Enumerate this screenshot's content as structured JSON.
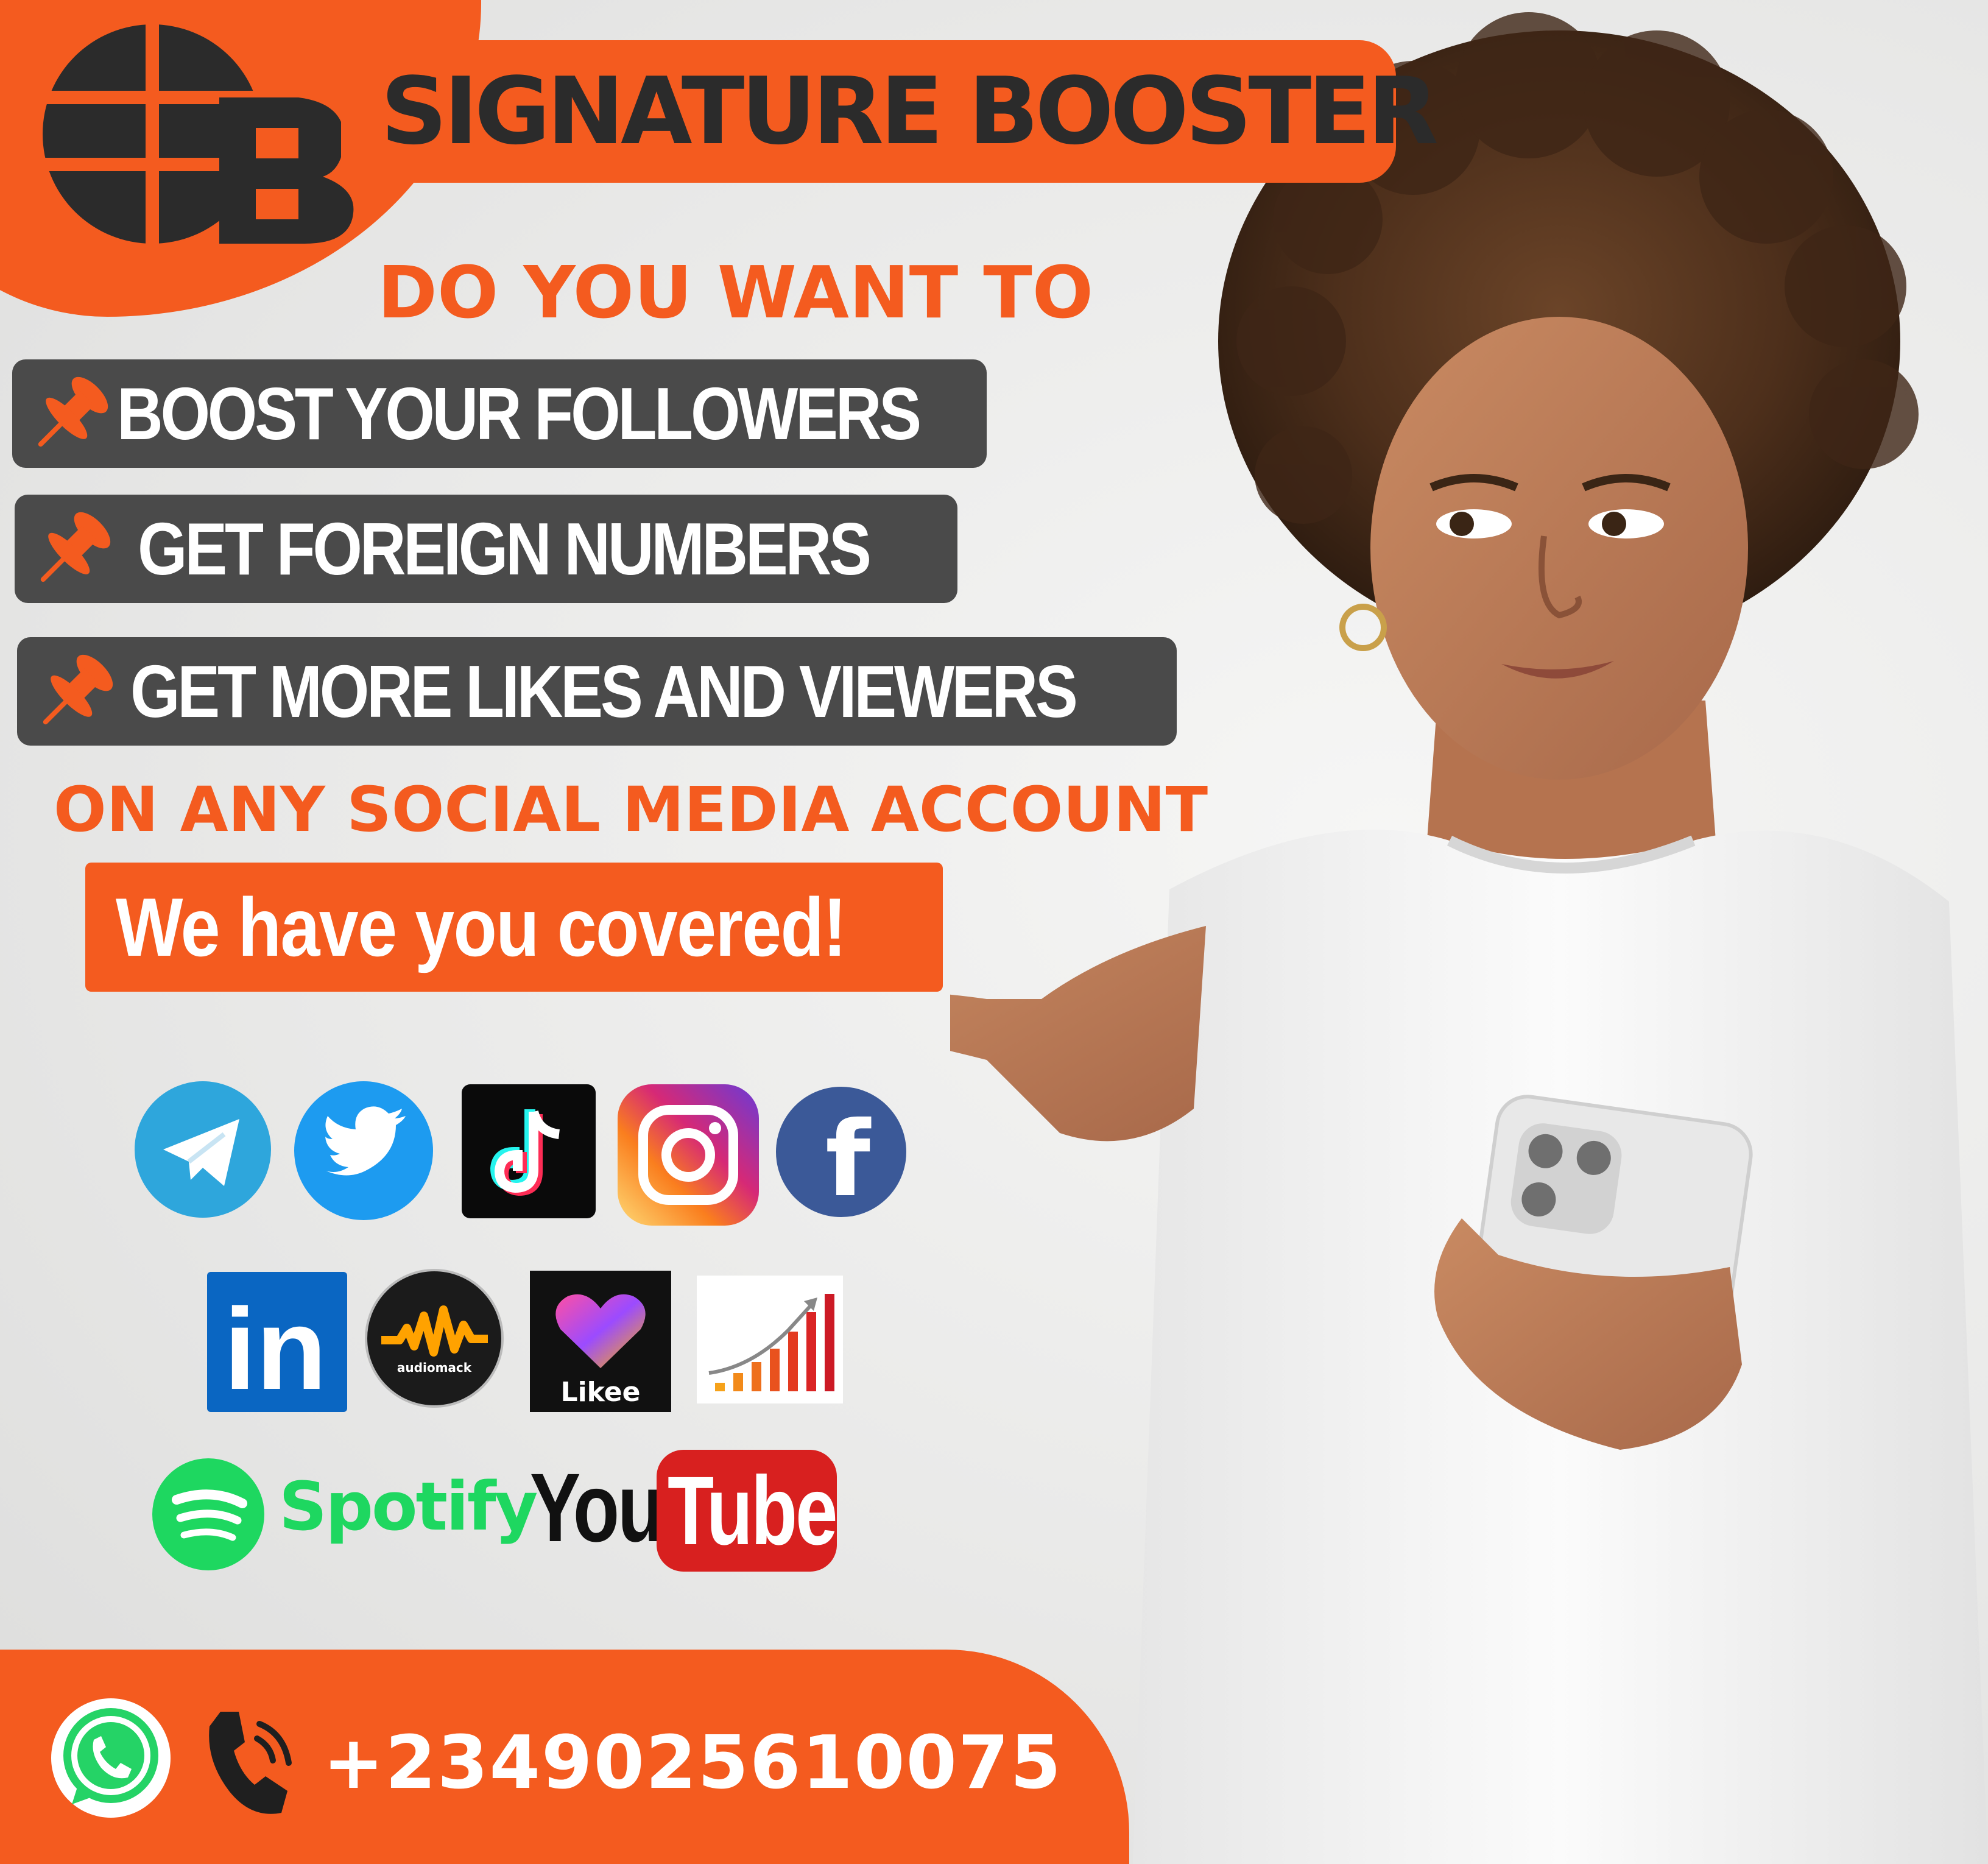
{
  "brand": {
    "monogram": "SB",
    "name": "SIGNATURE BOOSTER",
    "colors": {
      "orange": "#f45b1f",
      "dark": "#2b2b2b",
      "pill": "#4a4a4a"
    }
  },
  "headline": "DO YOU WANT TO",
  "features": [
    {
      "label": "BOOST YOUR FOLLOWERS",
      "icon": "pushpin-icon"
    },
    {
      "label": "GET FOREIGN NUMBERS",
      "icon": "pushpin-icon"
    },
    {
      "label": "GET MORE LIKES AND VIEWERS",
      "icon": "pushpin-icon"
    }
  ],
  "subline": "ON ANY SOCIAL MEDIA ACCOUNT",
  "cta": "We have you covered!",
  "platforms": {
    "row1": [
      "telegram-icon",
      "twitter-icon",
      "tiktok-icon",
      "instagram-icon",
      "facebook-icon"
    ],
    "row2": [
      "linkedin-icon",
      "audiomack-icon",
      "likee-icon",
      "growth-chart-icon"
    ],
    "linkedin_text": "in",
    "facebook_text": "f",
    "audiomack_text": "audiomack",
    "likee_text": "Likee",
    "spotify_text": "Spotify",
    "youtube_you": "You",
    "youtube_tube": "Tube"
  },
  "contact": {
    "icons": [
      "whatsapp-icon",
      "phone-icon"
    ],
    "phone": "+2349025610075"
  }
}
